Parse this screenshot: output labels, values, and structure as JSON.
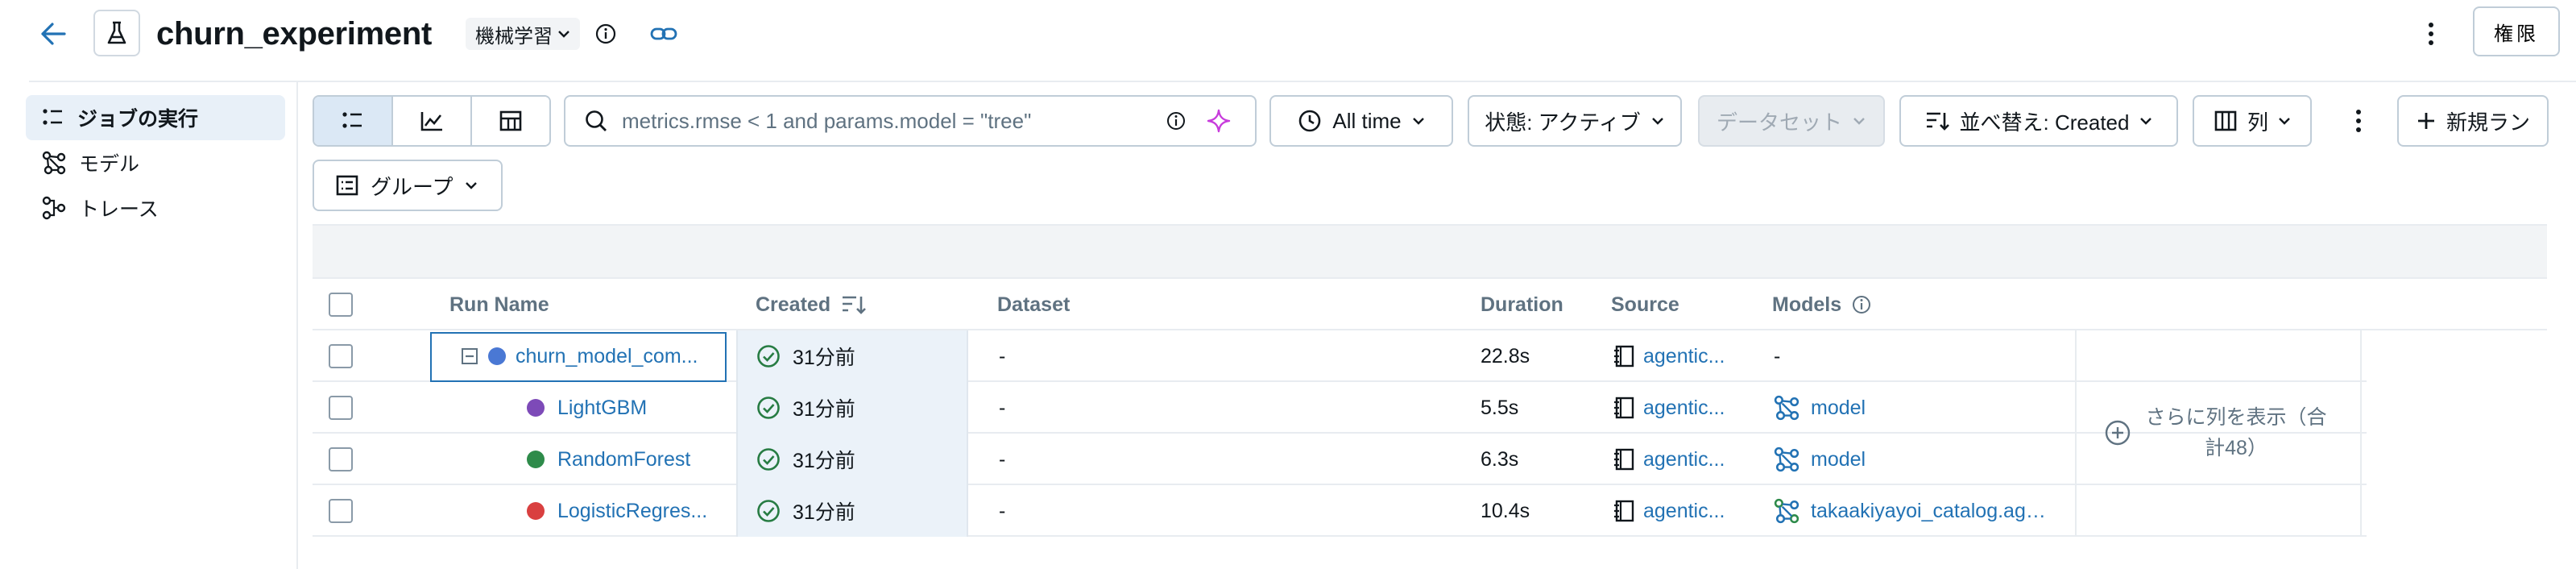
{
  "header": {
    "title": "churn_experiment",
    "type_tag": "機械学習",
    "permissions_label": "権限"
  },
  "sidebar": {
    "items": [
      {
        "label": "ジョブの実行",
        "icon": "list-icon",
        "active": true
      },
      {
        "label": "モデル",
        "icon": "model-graph-icon",
        "active": false
      },
      {
        "label": "トレース",
        "icon": "trace-icon",
        "active": false
      }
    ]
  },
  "toolbar": {
    "search_value": "metrics.rmse < 1 and params.model = \"tree\"",
    "time_filter": "All time",
    "state_filter": "状態: アクティブ",
    "dataset_filter": "データセット",
    "sort_label": "並べ替え: Created",
    "columns_label": "列",
    "new_run_label": "新規ラン",
    "group_label": "グループ"
  },
  "table": {
    "columns": [
      "Run Name",
      "Created",
      "Dataset",
      "Duration",
      "Source",
      "Models"
    ],
    "rows": [
      {
        "name": "churn_model_com...",
        "color": "#4a78d4",
        "created": "31分前",
        "dataset": "-",
        "duration": "22.8s",
        "source": "agentic...",
        "model": "-",
        "is_parent": true
      },
      {
        "name": "LightGBM",
        "color": "#7d4ab8",
        "created": "31分前",
        "dataset": "-",
        "duration": "5.5s",
        "source": "agentic...",
        "model": "model",
        "is_parent": false
      },
      {
        "name": "RandomForest",
        "color": "#2e8b4a",
        "created": "31分前",
        "dataset": "-",
        "duration": "6.3s",
        "source": "agentic...",
        "model": "model",
        "is_parent": false
      },
      {
        "name": "LogisticRegres...",
        "color": "#d94040",
        "created": "31分前",
        "dataset": "-",
        "duration": "10.4s",
        "source": "agentic...",
        "model": "takaakiyayoi_catalog.age...",
        "is_parent": false
      }
    ],
    "more_columns_label": "さらに列を表示（合計48）"
  },
  "colors": {
    "accent": "#2272b4",
    "success": "#277c43",
    "active_bg": "#e8f0f8"
  }
}
